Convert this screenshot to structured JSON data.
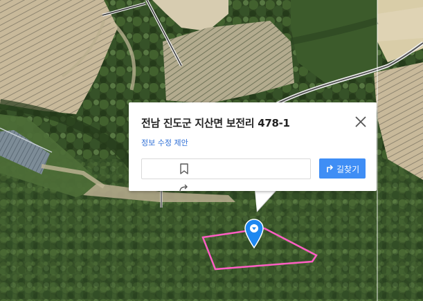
{
  "map": {
    "type": "satellite",
    "marker_icon": "location-pin-icon",
    "parcel_outline_color": "#ff5fc4",
    "marker_color": "#1e88f0"
  },
  "popup": {
    "title": "전남 진도군 지산면 보전리 478-1",
    "edit_link": "정보 수정 제안",
    "route_button": "길찾기",
    "icons": {
      "close": "close-icon",
      "bookmark": "bookmark-icon",
      "share": "share-icon",
      "route": "route-icon"
    },
    "accent_color": "#3f8ef5"
  }
}
